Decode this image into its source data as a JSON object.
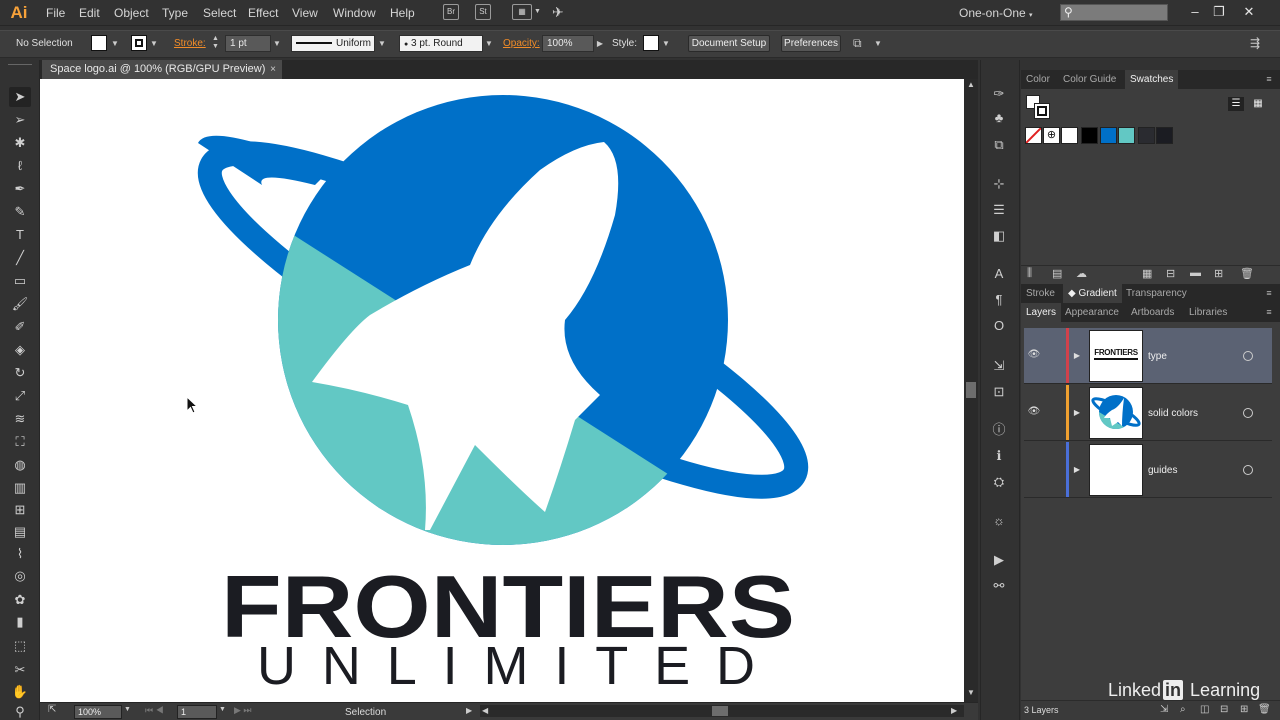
{
  "app": {
    "logo": "Ai"
  },
  "menu": {
    "items": [
      "File",
      "Edit",
      "Object",
      "Type",
      "Select",
      "Effect",
      "View",
      "Window",
      "Help"
    ],
    "bridge": "Br",
    "stock": "St",
    "workspace": "One-on-One",
    "search_placeholder": ""
  },
  "control_bar": {
    "selection_label": "No Selection",
    "stroke_label": "Stroke:",
    "stroke_weight": "1 pt",
    "profile_label": "Uniform",
    "brush_label": "3 pt. Round",
    "opacity_label": "Opacity:",
    "opacity_value": "100%",
    "style_label": "Style:",
    "document_setup": "Document Setup",
    "preferences": "Preferences"
  },
  "document": {
    "tab_title": "Space logo.ai @ 100% (RGB/GPU Preview)",
    "close_glyph": "×"
  },
  "artwork": {
    "headline": "FRONTIERS",
    "subline": "UNLIMITED",
    "colors": {
      "blue": "#0070c8",
      "teal": "#62c8c4",
      "text": "#1b1c22"
    }
  },
  "status_bar": {
    "zoom": "100%",
    "artboard": "1",
    "tool": "Selection"
  },
  "swatches_panel": {
    "tabs": [
      "Color",
      "Color Guide",
      "Swatches"
    ],
    "active_tab": "Swatches"
  },
  "gradient_panel": {
    "tabs": [
      "Stroke",
      "Gradient",
      "Transparency"
    ],
    "active_tab": "Gradient"
  },
  "layers_panel": {
    "tabs": [
      "Layers",
      "Appearance",
      "Artboards",
      "Libraries"
    ],
    "active_tab": "Layers",
    "layers": [
      {
        "name": "type",
        "color": "#d2414b",
        "visible": true,
        "selected": true,
        "thumb_text": "FRONTIERS"
      },
      {
        "name": "solid colors",
        "color": "#f0a030",
        "visible": true,
        "selected": false
      },
      {
        "name": "guides",
        "color": "#4a6fd8",
        "visible": false,
        "selected": false
      }
    ],
    "count": "3 Layers"
  },
  "watermark": {
    "before": "Linked",
    "in": "in",
    "after": " Learning"
  }
}
